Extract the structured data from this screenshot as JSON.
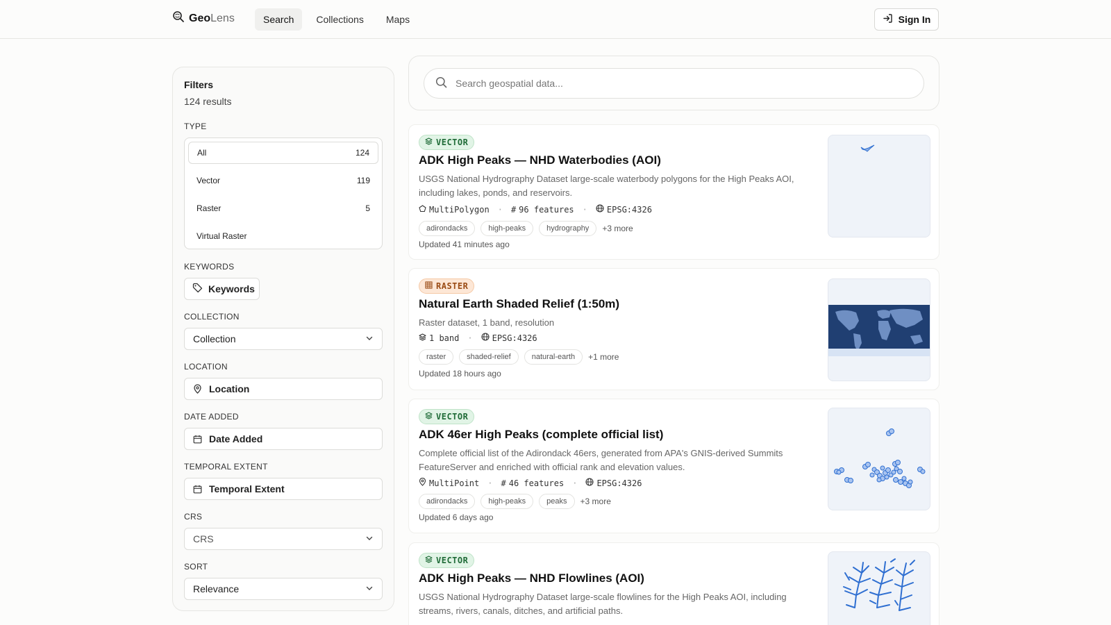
{
  "header": {
    "logo_bold": "Geo",
    "logo_light": "Lens",
    "nav": [
      {
        "label": "Search"
      },
      {
        "label": "Collections"
      },
      {
        "label": "Maps"
      }
    ],
    "signin_label": "Sign In"
  },
  "filters": {
    "title": "Filters",
    "count": "124 results",
    "type_label": "TYPE",
    "types": [
      {
        "label": "All",
        "count": "124"
      },
      {
        "label": "Vector",
        "count": "119"
      },
      {
        "label": "Raster",
        "count": "5"
      },
      {
        "label": "Virtual Raster",
        "count": ""
      }
    ],
    "keywords_label": "KEYWORDS",
    "keywords_button": "Keywords",
    "collection_label": "COLLECTION",
    "collection_value": "Collection",
    "location_label": "LOCATION",
    "location_value": "Location",
    "date_label": "DATE ADDED",
    "date_value": "Date Added",
    "temporal_label": "TEMPORAL EXTENT",
    "temporal_value": "Temporal Extent",
    "crs_label": "CRS",
    "crs_value": "CRS",
    "sort_label": "SORT",
    "sort_value": "Relevance"
  },
  "search": {
    "placeholder": "Search geospatial data..."
  },
  "results": [
    {
      "badge": "VECTOR",
      "title": "ADK High Peaks — NHD Waterbodies (AOI)",
      "desc1": "USGS National Hydrography Dataset large-scale waterbody polygons for the High Peaks AOI,",
      "desc2": "including lakes, ponds, and reservoirs.",
      "geom": "MultiPolygon",
      "features": "96 features",
      "crs": "EPSG:4326",
      "tags": [
        "adirondacks",
        "high-peaks",
        "hydrography"
      ],
      "more": "+3 more",
      "updated": "Updated 41 minutes ago"
    },
    {
      "badge": "RASTER",
      "title": "Natural Earth Shaded Relief (1:50m)",
      "desc1": "Raster dataset, 1 band, resolution",
      "bands": "1 band",
      "crs": "EPSG:4326",
      "tags": [
        "raster",
        "shaded-relief",
        "natural-earth"
      ],
      "more": "+1 more",
      "updated": "Updated 18 hours ago"
    },
    {
      "badge": "VECTOR",
      "title": "ADK 46er High Peaks (complete official list)",
      "desc1": "Complete official list of the Adirondack 46ers, generated from APA's GNIS-derived Summits",
      "desc2": "FeatureServer and enriched with official rank and elevation values.",
      "geom": "MultiPoint",
      "features": "46 features",
      "crs": "EPSG:4326",
      "tags": [
        "adirondacks",
        "high-peaks",
        "peaks"
      ],
      "more": "+3 more",
      "updated": "Updated 6 days ago"
    },
    {
      "badge": "VECTOR",
      "title": "ADK High Peaks — NHD Flowlines (AOI)",
      "desc1": "USGS National Hydrography Dataset large-scale flowlines for the High Peaks AOI, including",
      "desc2": "streams, rivers, canals, ditches, and artificial paths."
    }
  ],
  "colors": {
    "vector_badge_bg": "#e1f4e6",
    "raster_badge_bg": "#fde7d6",
    "map_blue": "#2f6fd1"
  }
}
